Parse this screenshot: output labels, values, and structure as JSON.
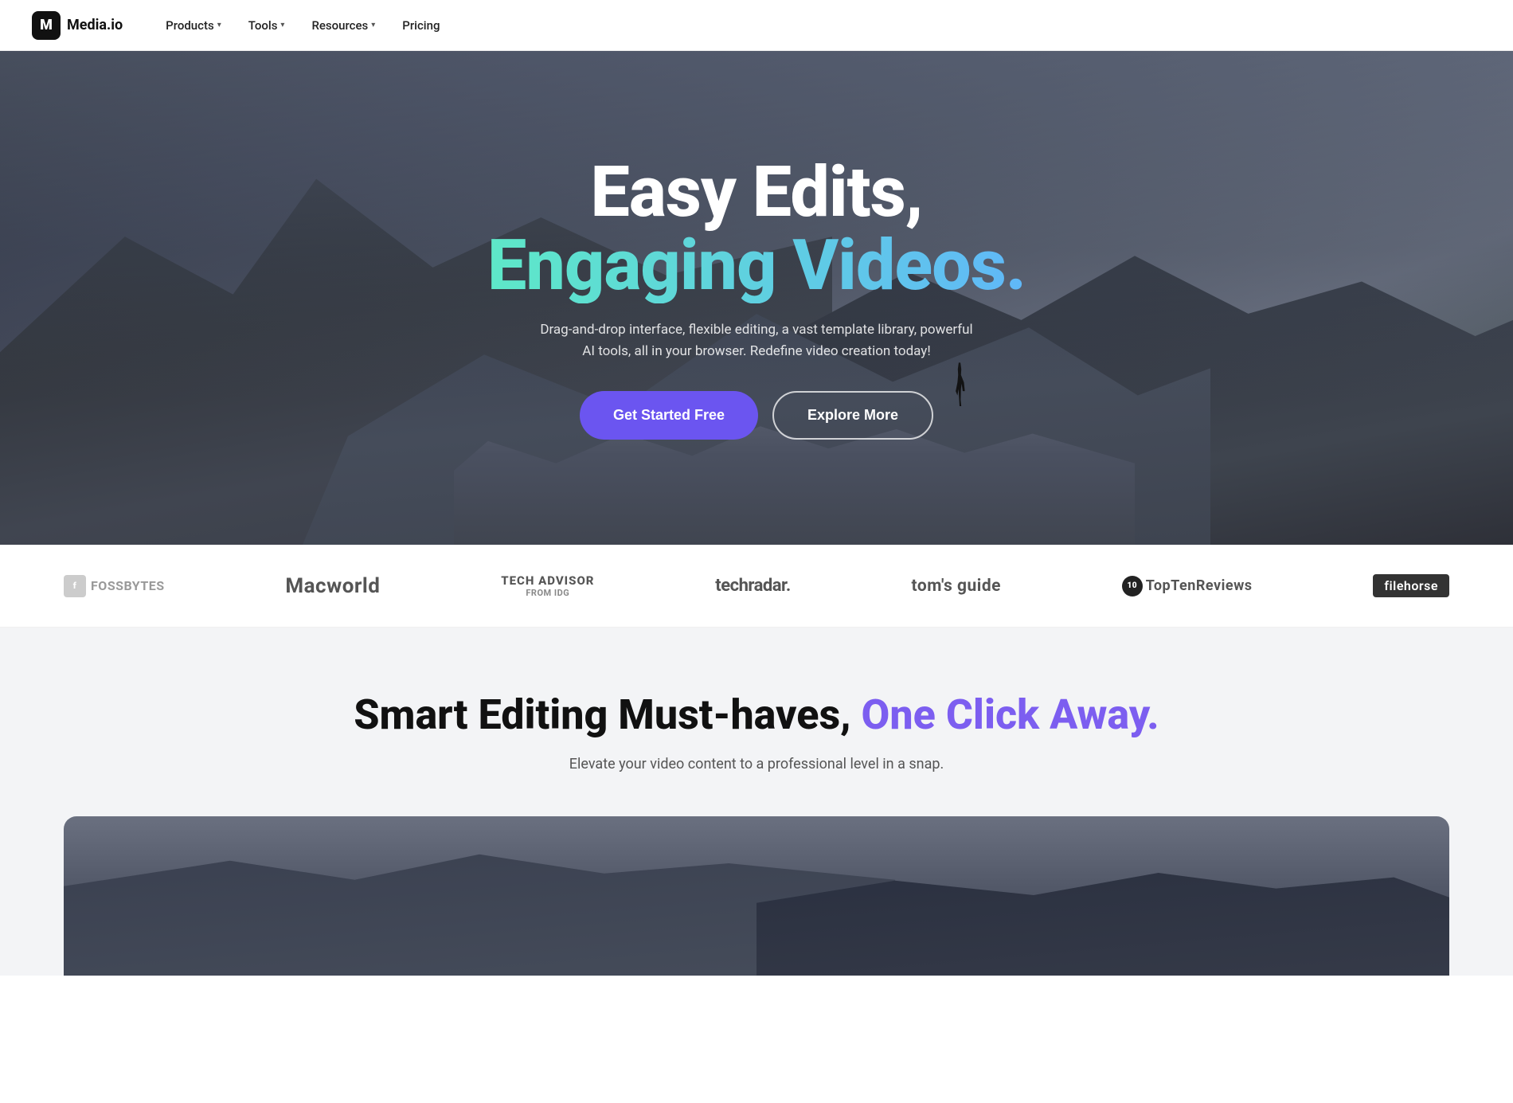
{
  "brand": {
    "logo_letter": "M",
    "logo_name": "Media.io"
  },
  "nav": {
    "links": [
      {
        "id": "products",
        "label": "Products",
        "has_dropdown": true
      },
      {
        "id": "tools",
        "label": "Tools",
        "has_dropdown": true
      },
      {
        "id": "resources",
        "label": "Resources",
        "has_dropdown": true
      },
      {
        "id": "pricing",
        "label": "Pricing",
        "has_dropdown": false
      }
    ]
  },
  "hero": {
    "title_line1": "Easy Edits,",
    "title_line2": "Engaging Videos.",
    "subtitle": "Drag-and-drop interface, flexible editing, a vast template library, powerful AI tools, all in your browser. Redefine video creation today!",
    "cta_primary": "Get Started Free",
    "cta_secondary": "Explore More"
  },
  "press": {
    "logos": [
      {
        "id": "fossbytes",
        "label": "FOSSBYTES"
      },
      {
        "id": "macworld",
        "label": "Macworld"
      },
      {
        "id": "techadviser",
        "label": "TECH ADVISOR\nFROM IDG"
      },
      {
        "id": "techradar",
        "label": "techradar."
      },
      {
        "id": "tomsguide",
        "label": "tom's guide"
      },
      {
        "id": "toptenreviews",
        "label": "TopTenReviews"
      },
      {
        "id": "filehorse",
        "label": "filehorse"
      }
    ]
  },
  "smart_section": {
    "title_part1": "Smart Editing Must-haves,",
    "title_part2": "One Click Away.",
    "subtitle": "Elevate your video content to a professional level in a snap."
  }
}
